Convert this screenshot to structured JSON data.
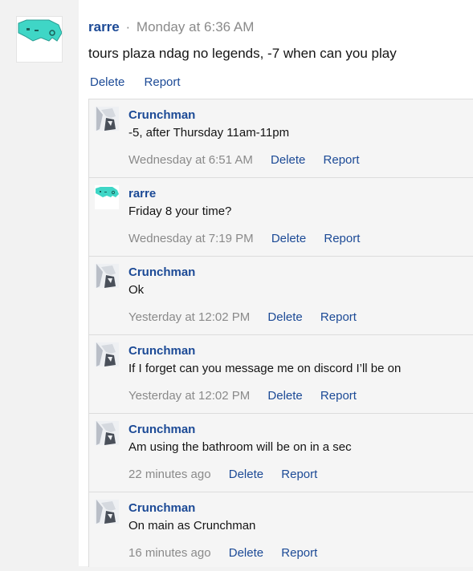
{
  "post": {
    "author": "rarre",
    "separator": "·",
    "time": "Monday at 6:36 AM",
    "body": "tours plaza ndag no legends, -7 when can you play",
    "delete_label": "Delete",
    "report_label": "Report"
  },
  "replies": [
    {
      "author": "Crunchman",
      "text": "-5, after Thursday 11am-11pm",
      "time": "Wednesday at 6:51 AM",
      "delete_label": "Delete",
      "report_label": "Report",
      "avatar": "crunchman-avatar"
    },
    {
      "author": "rarre",
      "text": "Friday 8 your time?",
      "time": "Wednesday at 7:19 PM",
      "delete_label": "Delete",
      "report_label": "Report",
      "avatar": "rarre-avatar"
    },
    {
      "author": "Crunchman",
      "text": "Ok",
      "time": "Yesterday at 12:02 PM",
      "delete_label": "Delete",
      "report_label": "Report",
      "avatar": "crunchman-avatar"
    },
    {
      "author": "Crunchman",
      "text": "If I forget can you message me on discord I’ll be on",
      "time": "Yesterday at 12:02 PM",
      "delete_label": "Delete",
      "report_label": "Report",
      "avatar": "crunchman-avatar"
    },
    {
      "author": "Crunchman",
      "text": "Am using the bathroom will be on in a sec",
      "time": "22 minutes ago",
      "delete_label": "Delete",
      "report_label": "Report",
      "avatar": "crunchman-avatar"
    },
    {
      "author": "Crunchman",
      "text": "On main as Crunchman",
      "time": "16 minutes ago",
      "delete_label": "Delete",
      "report_label": "Report",
      "avatar": "crunchman-avatar"
    }
  ],
  "colors": {
    "link": "#1c4a96",
    "muted": "#8a8a8a",
    "avatar_teal": "#3fd6c6"
  }
}
